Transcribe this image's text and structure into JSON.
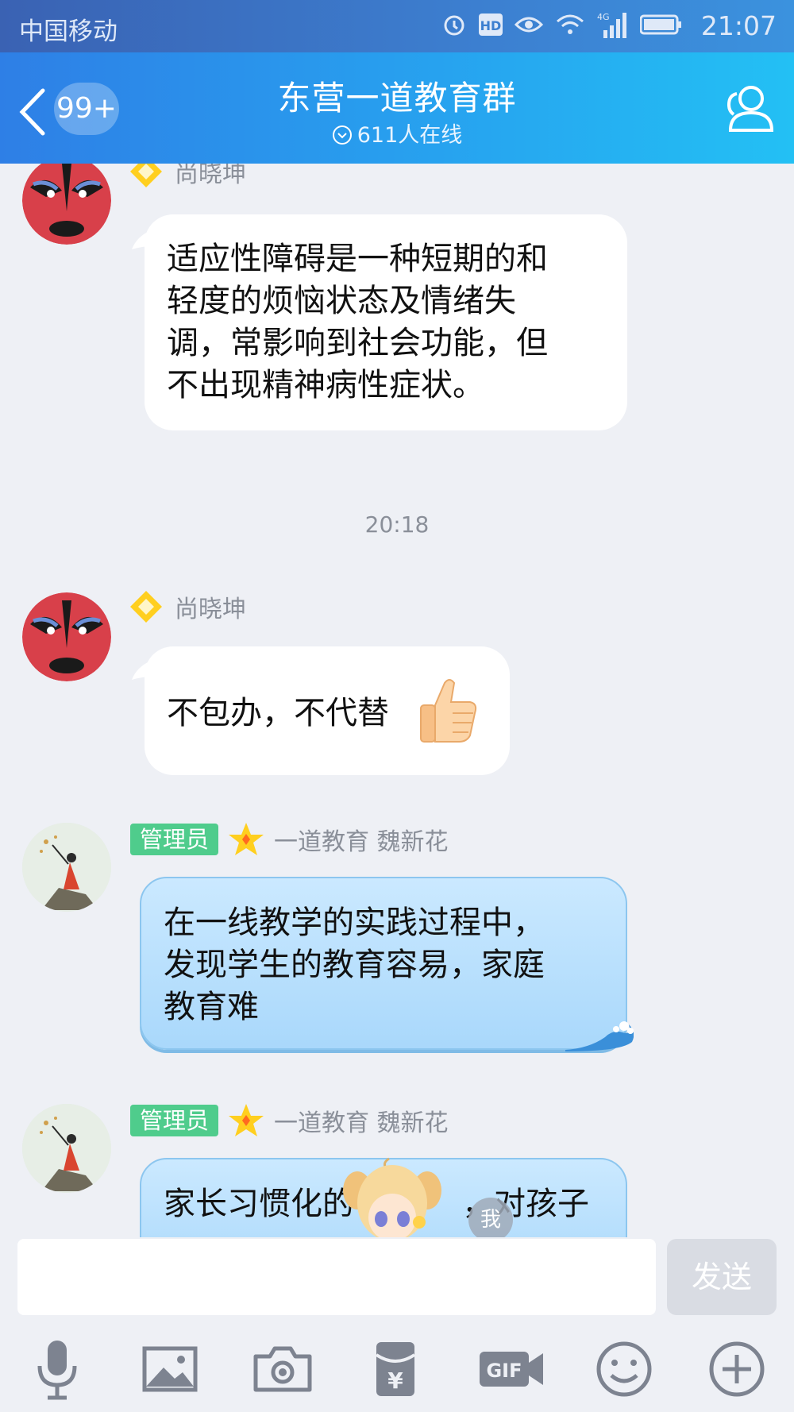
{
  "status_bar": {
    "carrier": "中国移动",
    "time": "21:07",
    "icons": [
      "alarm-icon",
      "hd-icon",
      "eye-icon",
      "wifi-icon",
      "4g-signal-icon",
      "battery-icon"
    ],
    "network_label": "4G",
    "hd_label": "HD"
  },
  "header": {
    "title": "东营一道教育群",
    "unread_badge": "99+",
    "online_count": "611人在线",
    "accent_color": "#27a2ef"
  },
  "messages": [
    {
      "sender": "尚晓坤",
      "badge": "",
      "text": "适应性障碍是一种短期的和轻度的烦恼状态及情绪失调，常影响到社会功能，但不出现精神病性症状。",
      "lines": [
        "适应性障碍是一种短期的和",
        "轻度的烦恼状态及情绪失",
        "调，常影响到社会功能，但",
        "不出现精神病性症状。"
      ]
    },
    {
      "sender": "尚晓坤",
      "badge": "",
      "text": "不包办，不代替",
      "emoji": "thumbs-up-icon"
    },
    {
      "sender": "一道教育 魏新花",
      "badge": "管理员",
      "text": "在一线教学的实践过程中，发现学生的教育容易，家庭教育难",
      "lines": [
        "在一线教学的实践过程中，",
        "发现学生的教育容易，家庭",
        "教育难"
      ]
    },
    {
      "sender": "一道教育 魏新花",
      "badge": "管理员",
      "text": "家长习惯化的",
      "text_right": "，对孩子"
    }
  ],
  "timestamp": "20:18",
  "composer": {
    "input_value": "",
    "send_label": "发送",
    "tools": [
      "microphone-icon",
      "image-icon",
      "camera-icon",
      "red-packet-icon",
      "gif-icon",
      "emoji-icon",
      "plus-icon"
    ],
    "gif_label": "GIF",
    "red_packet_label": "¥"
  },
  "overlay": {
    "me_label": "我"
  }
}
